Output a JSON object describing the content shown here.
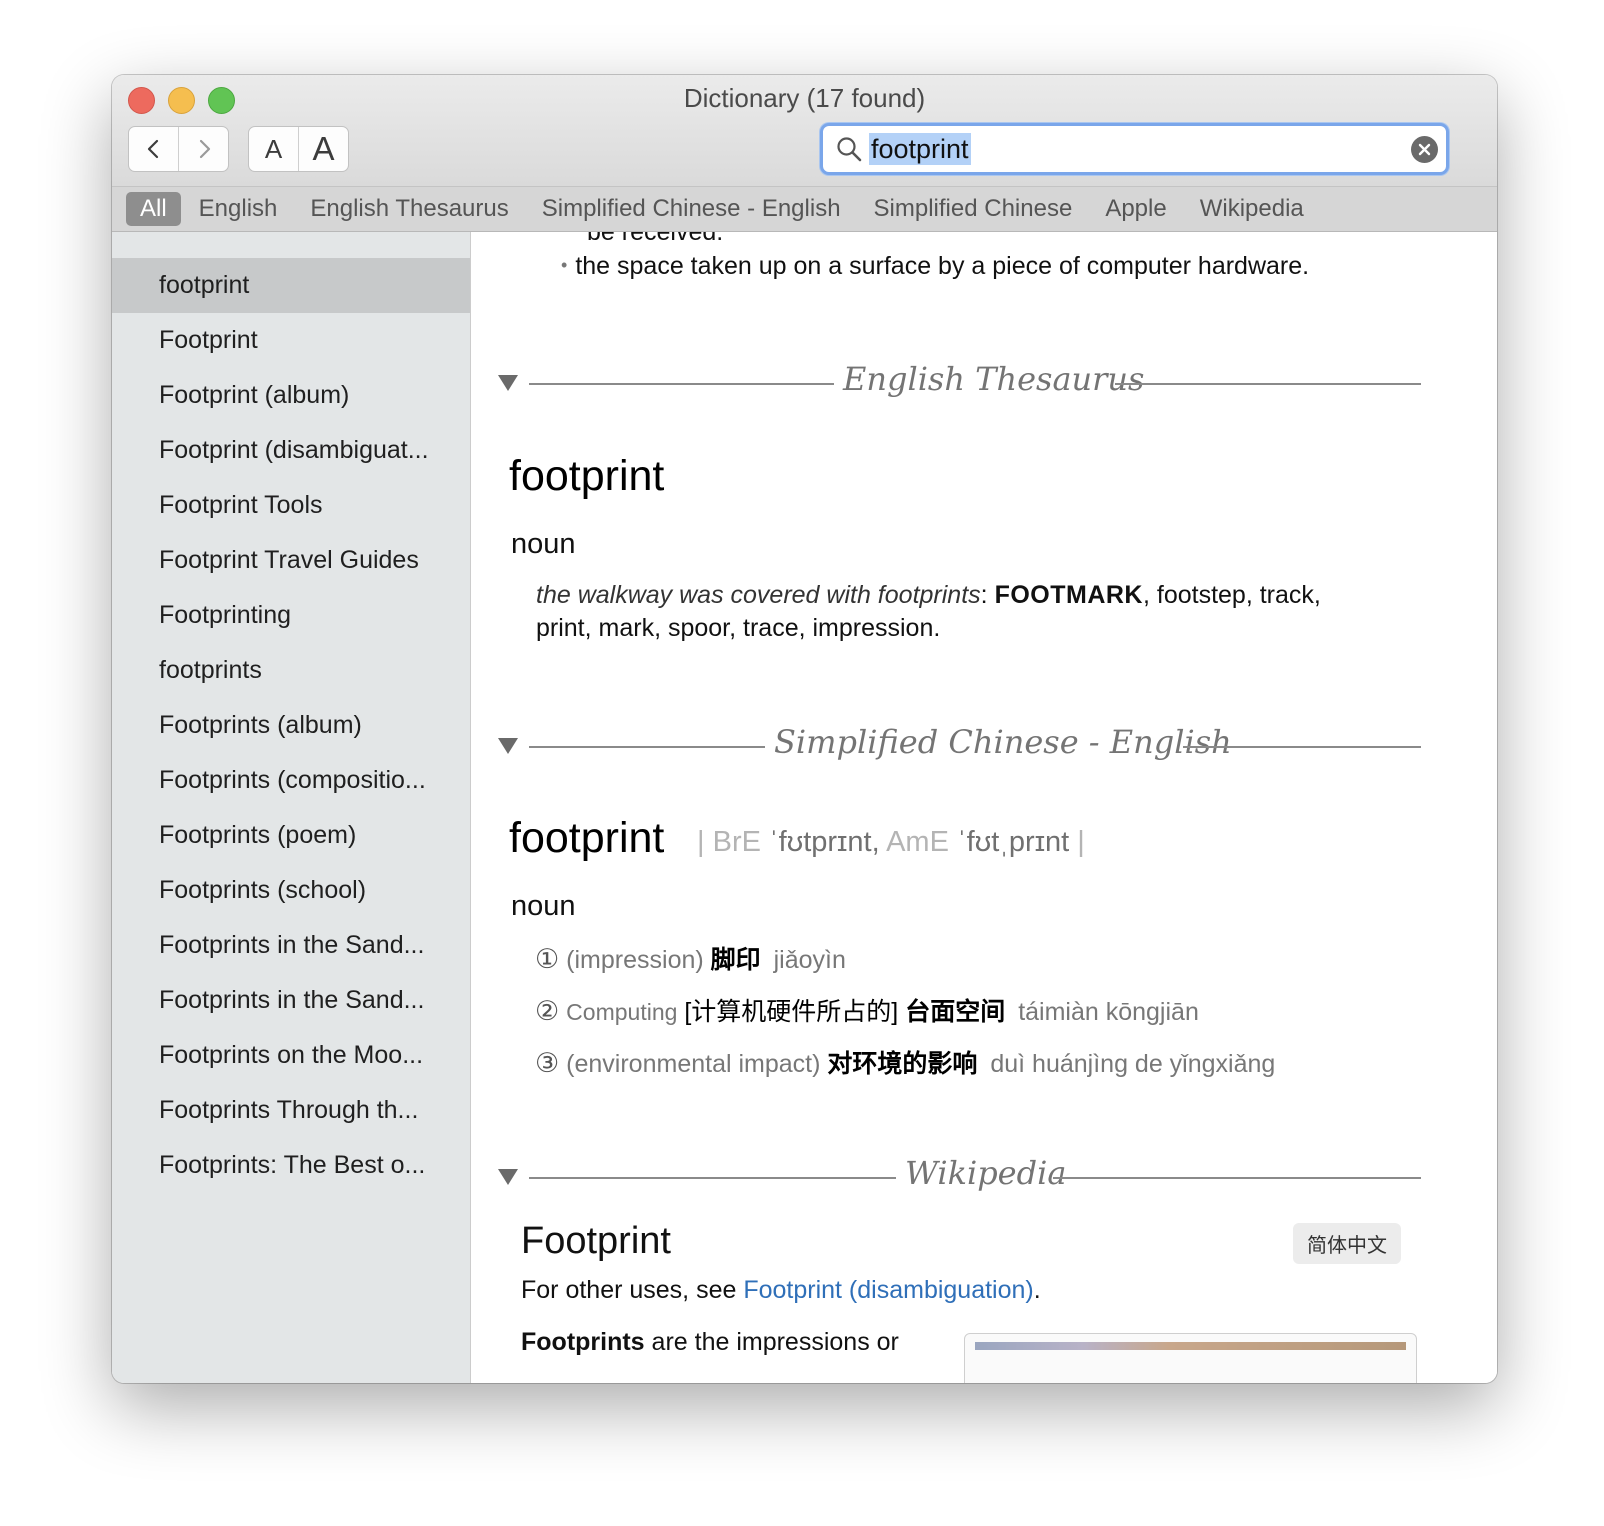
{
  "window": {
    "title": "Dictionary (17 found)"
  },
  "toolbar": {
    "back_icon": "chevron-left-icon",
    "forward_icon": "chevron-right-icon",
    "font_smaller_label": "A",
    "font_larger_label": "A",
    "search": {
      "value": "footprint",
      "icon": "search-icon",
      "clear_icon": "clear-icon"
    }
  },
  "scopes": [
    {
      "label": "All",
      "active": true
    },
    {
      "label": "English",
      "active": false
    },
    {
      "label": "English Thesaurus",
      "active": false
    },
    {
      "label": "Simplified Chinese - English",
      "active": false
    },
    {
      "label": "Simplified Chinese",
      "active": false
    },
    {
      "label": "Apple",
      "active": false
    },
    {
      "label": "Wikipedia",
      "active": false
    }
  ],
  "sidebar": {
    "items": [
      "footprint",
      "Footprint",
      "Footprint (album)",
      "Footprint (disambiguat...",
      "Footprint Tools",
      "Footprint Travel Guides",
      "Footprinting",
      "footprints",
      "Footprints (album)",
      "Footprints (compositio...",
      "Footprints (poem)",
      "Footprints (school)",
      "Footprints in the Sand...",
      "Footprints in the Sand...",
      "Footprints on the Moo...",
      "Footprints Through th...",
      "Footprints: The Best o..."
    ],
    "selected_index": 0
  },
  "content": {
    "prev_tail": "be received.",
    "prev_bullet": "the space taken up on a surface by a piece of computer hardware.",
    "thesaurus": {
      "title": "English Thesaurus",
      "headword": "footprint",
      "pos": "noun",
      "example": "the walkway was covered with footprints",
      "colon": ":",
      "synonym_main": "FOOTMARK",
      "synonyms_line1": ", footstep, track,",
      "synonyms_line2": "print, mark, spoor, trace, impression."
    },
    "chinese": {
      "title": "Simplified Chinese - English",
      "headword": "footprint",
      "pron_bar_open": "|",
      "pron_bre_label": "BrE",
      "pron_bre": "ˈfʊtprɪnt,",
      "pron_ame_label": "AmE",
      "pron_ame": "ˈfʊtˌprɪnt",
      "pron_bar_close": "|",
      "pos": "noun",
      "senses": [
        {
          "num": "①",
          "gloss": "(impression)",
          "hanzi": "脚印",
          "pinyin": "jiǎoyìn"
        },
        {
          "num": "②",
          "label": "Computing",
          "bracket": "[计算机硬件所占的]",
          "hanzi": "台面空间",
          "pinyin": "táimiàn kōngjiān"
        },
        {
          "num": "③",
          "gloss": "(environmental impact)",
          "hanzi": "对环境的影响",
          "pinyin": "duì huánjìng de yǐngxiǎng"
        }
      ]
    },
    "wikipedia": {
      "title": "Wikipedia",
      "article_title": "Footprint",
      "language_badge": "简体中文",
      "other_uses_prefix": "For other uses, see ",
      "other_uses_link": "Footprint (disambiguation)",
      "other_uses_suffix": ".",
      "body_bold": "Footprints",
      "body_rest": " are the impressions or"
    }
  }
}
